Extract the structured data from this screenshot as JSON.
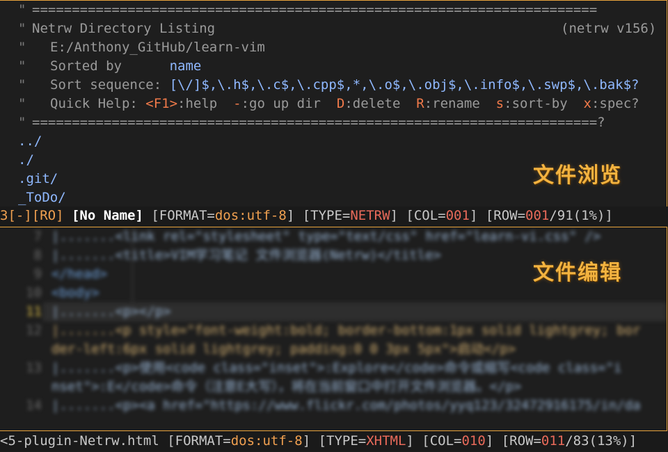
{
  "top_pane": {
    "separator": "=======================================================================",
    "title": "Netrw Directory Listing",
    "version": "(netrw v156)",
    "path": "E:/Anthony_GitHub/learn-vim",
    "sorted_by_label": "Sorted by      ",
    "sorted_by_value": "name",
    "sort_seq_label": "Sort sequence: ",
    "sort_seq_value": "[\\/]$,\\.h$,\\.c$,\\.cpp$,*,\\.o$,\\.obj$,\\.info$,\\.swp$,\\.bak$?",
    "quick_help_label": "Quick Help: ",
    "quick_help": [
      {
        "key": "<F1>",
        "text": ":help  "
      },
      {
        "key": "-",
        "text": ":go up dir  "
      },
      {
        "key": "D",
        "text": ":delete  "
      },
      {
        "key": "R",
        "text": ":rename  "
      },
      {
        "key": "s",
        "text": ":sort-by  "
      },
      {
        "key": "x",
        "text": ":spec?"
      }
    ],
    "bottom_separator": "=======================================================================?",
    "entries": [
      "../",
      "./",
      ".git/",
      "_ToDo/"
    ],
    "overlay_label": "文件浏览"
  },
  "top_status": {
    "prefix": "3[-][RO] ",
    "buffer_name": "[No Name]",
    "format_label": " [FORMAT=",
    "format_value": "dos:utf-8",
    "type_label": "] [TYPE=",
    "type_value": "NETRW",
    "col_label": "] [COL=",
    "col_value": "001",
    "row_label": "] [ROW=",
    "row_value": "001",
    "row_total": "/91(1%)]"
  },
  "bottom_pane": {
    "overlay_label": "文件编辑",
    "line_numbers": [
      "7",
      "8",
      "9",
      "10",
      "11",
      "12",
      "",
      "13",
      "",
      "14"
    ],
    "lines": [
      "|.......<link rel=\"stylesheet\" type=\"text/css\" href=\"learn-vi.css\" />",
      "|.......<title>VIM学习笔记 文件浏览器(Netrw)</title>",
      "</head>",
      "<body>",
      "|.......<p></p>",
      "|.......<p style=\"font-weight:bold; border-bottom:1px solid lightgrey; bor",
      "der-left:6px solid lightgrey; padding:0 0 3px 5px\">启动</p>",
      "|.......<p>使用<code class=\"inset\">:Explore</code>命令或缩写<code class=\"i",
      "nset\">:E</code>命令（注意E大写），将在当前窗口中打开文件浏览器。</p>",
      "|.......<p><a href=\"https://www.flickr.com/photos/yyq123/32472916175/in/da"
    ]
  },
  "bottom_status": {
    "file_name": "<5-plugin-Netrw.html",
    "format_label": " [FORMAT=",
    "format_value": "dos:utf-8",
    "type_label": "] [TYPE=",
    "type_value": "XHTML",
    "col_label": "] [COL=",
    "col_value": "010",
    "row_label": "] [ROW=",
    "row_value": "011",
    "row_total": "/83(13%)]"
  }
}
